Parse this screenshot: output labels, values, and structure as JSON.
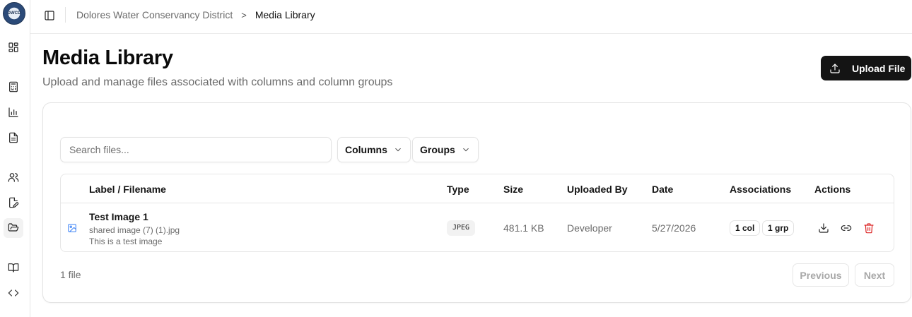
{
  "app": {
    "logo_text": "DWCD"
  },
  "sidebar": {
    "items": [
      {
        "icon": "dashboard-icon",
        "name": "Dashboard"
      },
      {
        "icon": "calculator-icon",
        "name": "Calculator"
      },
      {
        "icon": "bar-chart-icon",
        "name": "Charts"
      },
      {
        "icon": "document-icon",
        "name": "Documents"
      },
      {
        "icon": "users-icon",
        "name": "Users"
      },
      {
        "icon": "file-edit-icon",
        "name": "Edit files"
      },
      {
        "icon": "folder-open-icon",
        "name": "Media Library",
        "active": true
      },
      {
        "icon": "book-icon",
        "name": "Docs"
      },
      {
        "icon": "code-icon",
        "name": "Code"
      }
    ]
  },
  "header": {
    "breadcrumb": {
      "parent": "Dolores Water Conservancy District",
      "separator": ">",
      "current": "Media Library"
    }
  },
  "main": {
    "title": "Media Library",
    "subtitle": "Upload and manage files associated with columns and column groups",
    "upload_label": "Upload File"
  },
  "filters": {
    "search_placeholder": "Search files...",
    "columns_label": "Columns",
    "groups_label": "Groups"
  },
  "table": {
    "headers": {
      "label": "Label / Filename",
      "type": "Type",
      "size": "Size",
      "uploaded_by": "Uploaded By",
      "date": "Date",
      "associations": "Associations",
      "actions": "Actions"
    },
    "rows": [
      {
        "label": "Test Image 1",
        "filename": "shared image (7) (1).jpg",
        "description": "This is a test image",
        "type": "JPEG",
        "size": "481.1 KB",
        "uploaded_by": "Developer",
        "date": "5/27/2026",
        "assoc_columns": "1 col",
        "assoc_groups": "1 grp"
      }
    ]
  },
  "footer": {
    "count": "1 file",
    "previous_label": "Previous",
    "next_label": "Next"
  },
  "colors": {
    "primary_button": "#141414",
    "image_icon": "#3b82f6",
    "delete_icon": "#dc2626",
    "muted_text": "#6b6b6b"
  }
}
